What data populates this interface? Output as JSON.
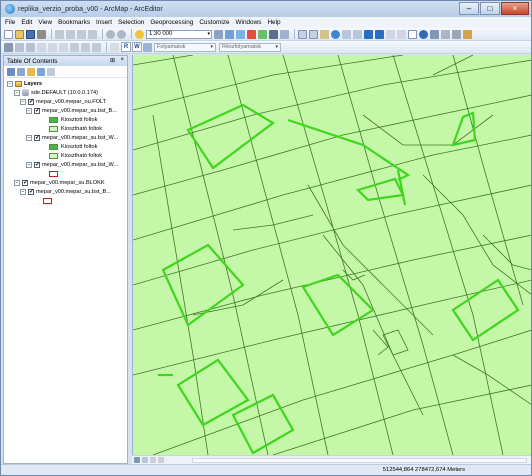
{
  "window": {
    "title": "replika_verzio_proba_v00 - ArcMap - ArcEditor",
    "minimize": "–",
    "maximize": "□",
    "close": "×"
  },
  "menu": [
    "File",
    "Edit",
    "View",
    "Bookmarks",
    "Insert",
    "Selection",
    "Geoprocessing",
    "Customize",
    "Windows",
    "Help"
  ],
  "toolbar": {
    "scale": "1:30 000",
    "scale_arrow": "▾",
    "layer_combo": "Folyamatok",
    "layer_combo2": "Részfolyamatok",
    "editor_r": "R",
    "editor_w": "W"
  },
  "toc": {
    "title": "Table Of Contents",
    "pin": "⊞",
    "close": "×",
    "layers_label": "Layers",
    "db_label": "sde.DEFAULT (10.0.0.174)",
    "items": [
      {
        "name": "mepar_v00.mepar_ou.FOLT"
      },
      {
        "name": "mepar_v00.mepar_su.bst_B..."
      },
      {
        "legend": "Kiosztott foltok"
      },
      {
        "legend": "Kiosztható foltok"
      },
      {
        "name": "mepar_v00.mepar_su.bst_W..."
      },
      {
        "legend": "Kiosztott foltok"
      },
      {
        "legend": "Kiosztható foltok"
      },
      {
        "name": "mepar_v00.mepar_su.bst_W..."
      },
      {
        "name": "mepar_v00.mepar_su.BLOKK"
      },
      {
        "name": "mepar_v00.mepar_su.bst_B..."
      }
    ]
  },
  "status": {
    "coords": "512544,864  278472,674 Meters"
  },
  "colors": {
    "map_fill": "#c4f7a7",
    "line_dark": "#3c7a26",
    "line_bright": "#3fd61d",
    "kiosztott": "#46b64a",
    "kioszthato": "#d5f8c0",
    "outline_red": "#d01818"
  }
}
